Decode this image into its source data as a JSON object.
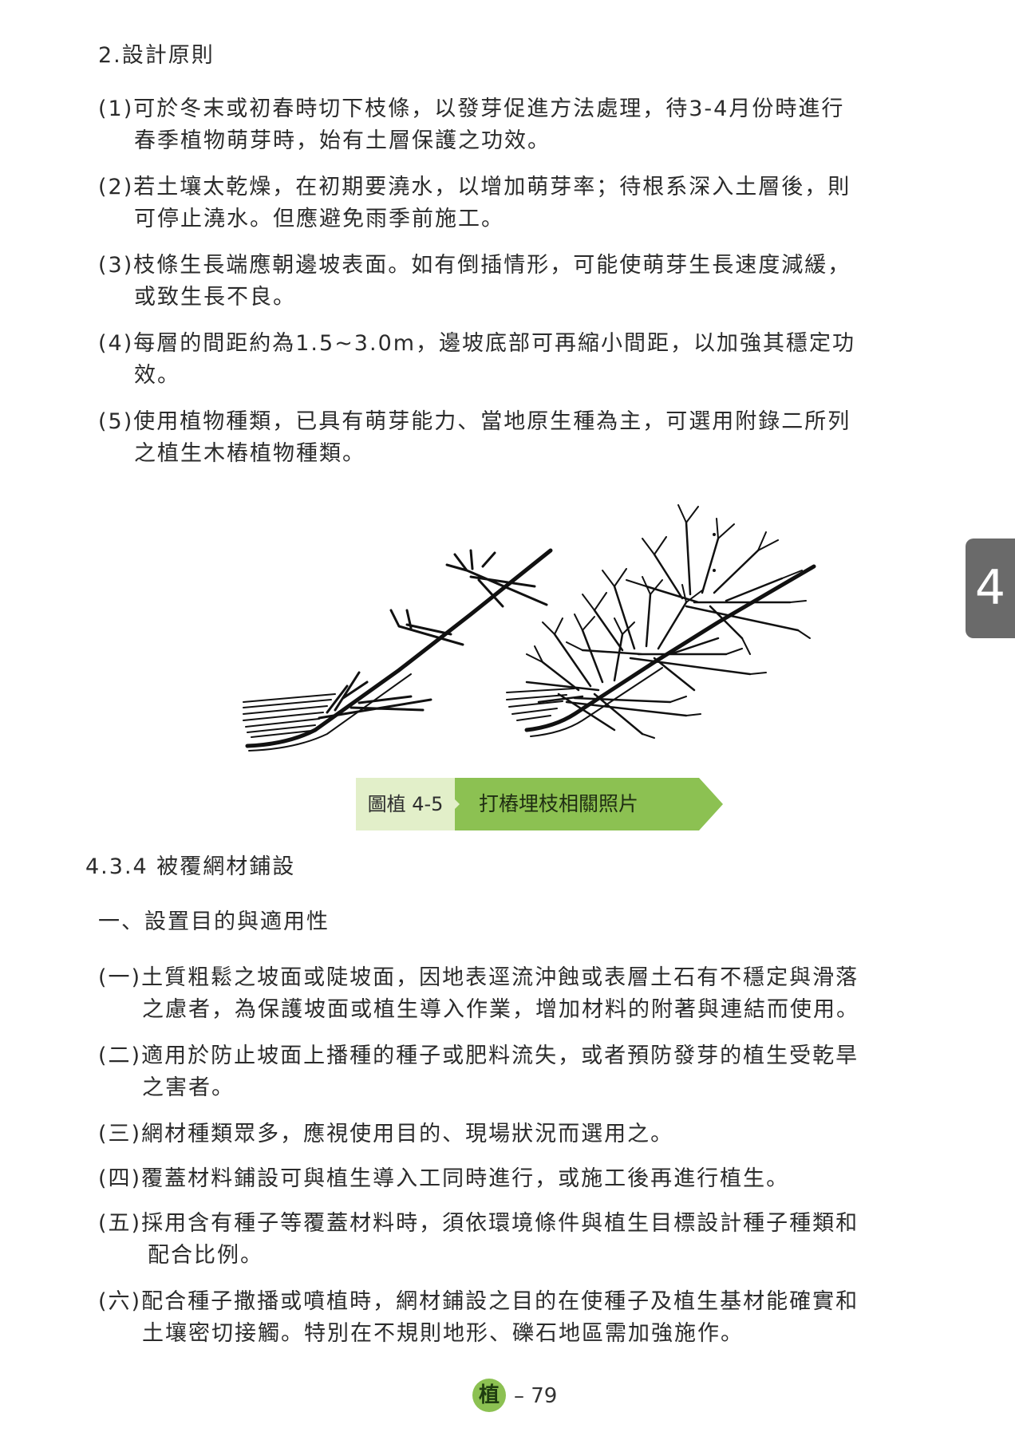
{
  "section_design_principles": {
    "heading": "2.設計原則",
    "items": [
      {
        "num": "(1)",
        "line1": "可於冬末或初春時切下枝條，以發芽促進方法處理，待3-4月份時進行",
        "line2": "春季植物萌芽時，始有土層保護之功效。"
      },
      {
        "num": "(2)",
        "line1": "若土壤太乾燥，在初期要澆水，以增加萌芽率；待根系深入土層後，則",
        "line2": "可停止澆水。但應避免雨季前施工。"
      },
      {
        "num": "(3)",
        "line1": "枝條生長端應朝邊坡表面。如有倒插情形，可能使萌芽生長速度減緩，",
        "line2": "或致生長不良。"
      },
      {
        "num": "(4)",
        "line1": "每層的間距約為1.5~3.0m，邊坡底部可再縮小間距，以加強其穩定功",
        "line2": "效。"
      },
      {
        "num": "(5)",
        "line1": "使用植物種類，已具有萌芽能力、當地原生種為主，可選用附錄二所列",
        "line2": "之植生木樁植物種類。"
      }
    ]
  },
  "figure": {
    "label": "圖植 4-5",
    "title": "打樁埋枝相關照片"
  },
  "section_net": {
    "heading": "4.3.4 被覆網材鋪設",
    "subheading": "一、設置目的與適用性",
    "items": [
      {
        "num": "(一)",
        "line1": "土質粗鬆之坡面或陡坡面，因地表逕流沖蝕或表層土石有不穩定與滑落",
        "line2": "之慮者，為保護坡面或植生導入作業，增加材料的附著與連結而使用。"
      },
      {
        "num": "(二)",
        "line1": "適用於防止坡面上播種的種子或肥料流失，或者預防發芽的植生受乾旱",
        "line2": "之害者。"
      },
      {
        "num": "(三)",
        "line1": "網材種類眾多，應視使用目的、現場狀況而選用之。",
        "line2": ""
      },
      {
        "num": "(四)",
        "line1": "覆蓋材料鋪設可與植生導入工同時進行，或施工後再進行植生。",
        "line2": ""
      },
      {
        "num": "(五)",
        "line1": "採用含有種子等覆蓋材料時，須依環境條件與植生目標設計種子種類和",
        "line2": "配合比例。"
      },
      {
        "num": "(六)",
        "line1": "配合種子撒播或噴植時，網材鋪設之目的在使種子及植生基材能確實和",
        "line2": "土壤密切接觸。特別在不規則地形、礫石地區需加強施作。"
      }
    ]
  },
  "chapter_tab": "4",
  "footer": {
    "badge": "植",
    "page": "– 79"
  },
  "colors": {
    "tab_gray": "#6a6a6a",
    "caption_light_green": "#e2efc9",
    "caption_green": "#8cc152"
  }
}
